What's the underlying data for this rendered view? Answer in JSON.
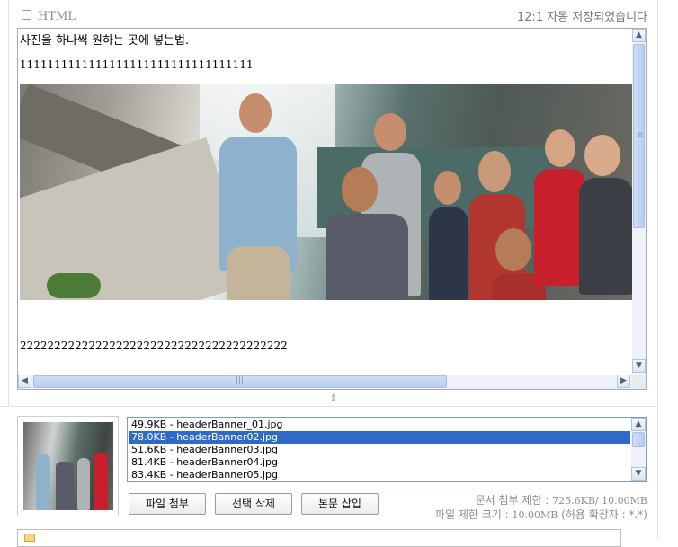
{
  "toolbar": {
    "html_label": "HTML",
    "autosave_text": "12:1 자동 저장되었습니다"
  },
  "editor": {
    "line1": "사진을 하나씩 원하는 곳에 넣는법.",
    "line2": "1111111111111111111111111111111111",
    "line3": "222222222222222222222222222222222222222"
  },
  "attachments": {
    "files": [
      {
        "size": "49.9KB",
        "name": "headerBanner_01.jpg",
        "label": "49.9KB - headerBanner_01.jpg"
      },
      {
        "size": "78.0KB",
        "name": "headerBanner02.jpg",
        "label": "78.0KB - headerBanner02.jpg",
        "selected": true
      },
      {
        "size": "51.6KB",
        "name": "headerBanner03.jpg",
        "label": "51.6KB - headerBanner03.jpg"
      },
      {
        "size": "81.4KB",
        "name": "headerBanner04.jpg",
        "label": "81.4KB - headerBanner04.jpg"
      },
      {
        "size": "83.4KB",
        "name": "headerBanner05.jpg",
        "label": "83.4KB - headerBanner05.jpg"
      }
    ],
    "buttons": {
      "attach": "파일 첨부",
      "delete_selected": "선택 삭제",
      "insert_body": "본문 삽입"
    },
    "limits": {
      "doc_label": "문서 첨부 제한 : ",
      "doc_value": "725.6KB/ 10.00MB",
      "file_label": "파일 제한 크기 : ",
      "file_value": "10.00MB",
      "file_suffix": " (허용 확장자 : *.*)"
    }
  },
  "icons": {
    "scroll_up": "arrow-up-icon",
    "scroll_down": "arrow-down-icon",
    "scroll_left": "arrow-left-icon",
    "scroll_right": "arrow-right-icon",
    "resize": "resize-handle-icon",
    "folder": "folder-icon"
  },
  "colors": {
    "selection": "#316ac5",
    "scrollbar_thumb": "#b9cdf0",
    "muted_text": "#8c8c8c"
  }
}
